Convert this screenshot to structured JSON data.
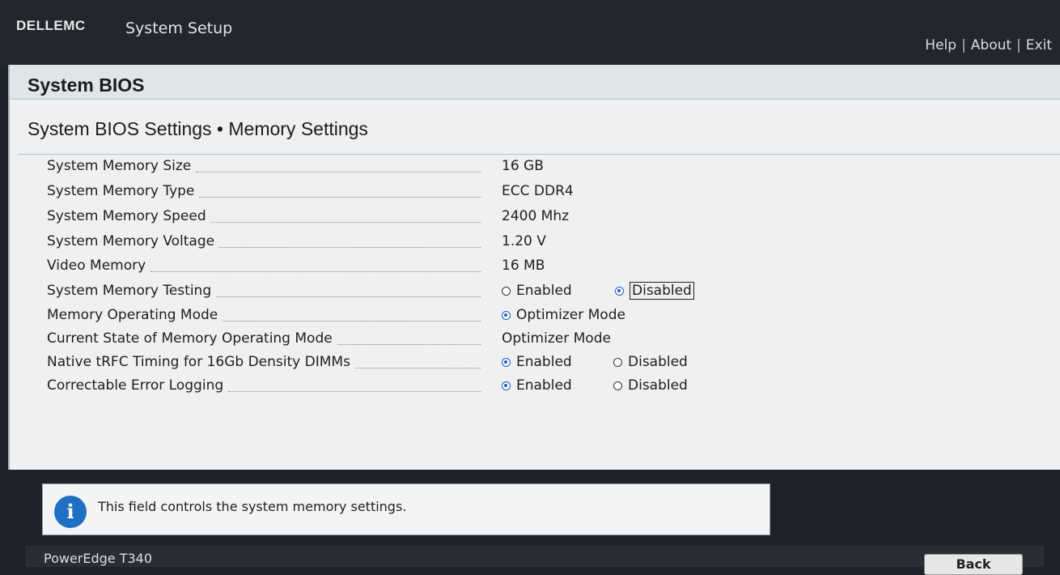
{
  "header": {
    "logo": "DELLEMC",
    "title": "System Setup",
    "links": [
      "Help",
      "About",
      "Exit"
    ]
  },
  "section_title": "System BIOS",
  "breadcrumb": "System BIOS Settings • Memory Settings",
  "settings": [
    {
      "label": "System Memory Size",
      "value": "16 GB"
    },
    {
      "label": "System Memory Type",
      "value": "ECC DDR4"
    },
    {
      "label": "System Memory Speed",
      "value": "2400 Mhz"
    },
    {
      "label": "System Memory Voltage",
      "value": "1.20 V"
    },
    {
      "label": "Video Memory",
      "value": "16 MB"
    },
    {
      "label": "System Memory Testing",
      "options": [
        "Enabled",
        "Disabled"
      ],
      "selected": "Disabled"
    },
    {
      "label": "Memory Operating Mode",
      "options": [
        "Optimizer Mode"
      ],
      "selected": "Optimizer Mode"
    },
    {
      "label": "Current State of Memory Operating Mode",
      "value": "Optimizer Mode"
    },
    {
      "label": "Native tRFC Timing for 16Gb Density DIMMs",
      "options": [
        "Enabled",
        "Disabled"
      ],
      "selected": "Enabled"
    },
    {
      "label": "Correctable Error Logging",
      "options": [
        "Enabled",
        "Disabled"
      ],
      "selected": "Enabled"
    }
  ],
  "info": "This field controls the system memory settings.",
  "footer": {
    "model": "PowerEdge T340",
    "back_label": "Back"
  },
  "colors": {
    "accent": "#1e5bc6",
    "header_bg": "#23262d",
    "panel_bg": "#eef0f2",
    "info_icon": "#1f6fc5"
  }
}
